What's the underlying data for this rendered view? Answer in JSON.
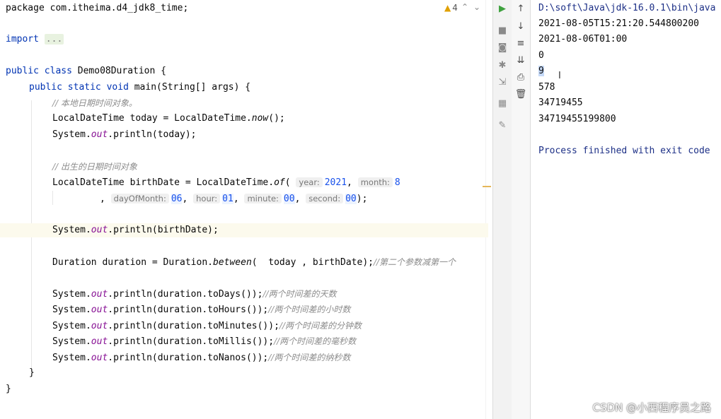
{
  "editor": {
    "warning_count": "4",
    "lines": {
      "package": "package com.itheima.d4_jdk8_time;",
      "import_kw": "import",
      "import_fold": "...",
      "class_kw1": "public",
      "class_kw2": "class",
      "class_name": "Demo08Duration {",
      "main_kw1": "public",
      "main_kw2": "static",
      "main_kw3": "void",
      "main_rest": "main(String[] args) {",
      "comment1": "// 本地日期时间对象。",
      "today_a": "LocalDateTime today = LocalDateTime.",
      "today_now": "now",
      "today_b": "();",
      "print_a": "System.",
      "print_out": "out",
      "print_today": ".println(today);",
      "comment2": "// 出生的日期时间对象",
      "birth_a": "LocalDateTime birthDate = LocalDateTime.",
      "birth_of": "of",
      "birth_paren": "(",
      "hint_year": "year:",
      "val_year": "2021",
      "hint_month": "month:",
      "val_month": "8",
      "hint_day": "dayOfMonth:",
      "val_day": "06",
      "hint_hour": "hour:",
      "val_hour": "01",
      "hint_minute": "minute:",
      "val_minute": "00",
      "hint_second": "second:",
      "val_second": "00",
      "birth_end": ");",
      "print_birth": ".println(birthDate);",
      "dur_a": "Duration duration = Duration.",
      "dur_between": "between",
      "dur_b": "(  today , birthDate);",
      "dur_comment": "//第二个参数减第一个",
      "days": ".println(duration.toDays());",
      "days_c": "//两个时间差的天数",
      "hours": ".println(duration.toHours());",
      "hours_c": "//两个时间差的小时数",
      "minutes": ".println(duration.toMinutes());",
      "minutes_c": "//两个时间差的分钟数",
      "millis": ".println(duration.toMillis());",
      "millis_c": "//两个时间差的毫秒数",
      "nanos": ".println(duration.toNanos());",
      "nanos_c": "//两个时间差的纳秒数",
      "close_method": "}",
      "close_class": "}"
    }
  },
  "toolbar_icons": [
    "run-icon",
    "stop-icon",
    "camera-icon",
    "debug-icon",
    "exit-icon",
    "layout-icon",
    "pin-icon",
    "up-arrow-icon",
    "down-arrow-icon",
    "soft-wrap-icon",
    "scroll-end-icon",
    "print-icon",
    "trash-icon"
  ],
  "console": {
    "cmd": "D:\\soft\\Java\\jdk-16.0.1\\bin\\java",
    "out1": "2021-08-05T15:21:20.544800200",
    "out2": "2021-08-06T01:00",
    "out3": "0",
    "out4": "9",
    "out5": "578",
    "out6": "34719455",
    "out7": "34719455199800",
    "finished": "Process finished with exit code"
  },
  "watermark": "CSDN @小西程序员之路",
  "colors": {
    "keyword": "#0033b3",
    "field": "#871094",
    "comment": "#8c8c8c",
    "number": "#1750eb",
    "run_green": "#3ea13e",
    "current_line": "#fcfaed"
  }
}
